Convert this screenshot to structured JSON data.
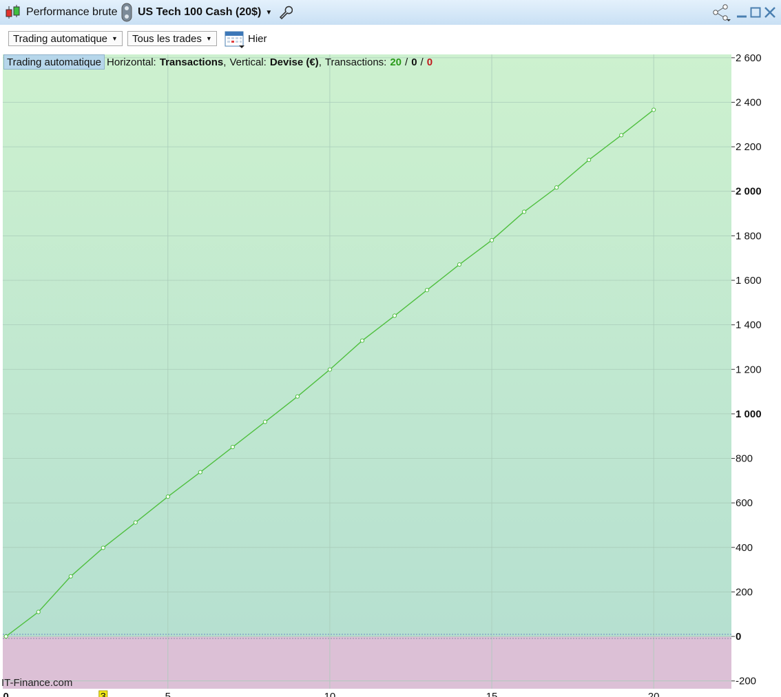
{
  "window": {
    "tab_title": "Performance brute",
    "instrument": "US Tech 100 Cash (20$)"
  },
  "toolbar": {
    "mode_label": "Trading automatique",
    "filter_label": "Tous les trades",
    "date_label": "Hier"
  },
  "infobar": {
    "tag": "Trading automatique",
    "horizontal_label": "Horizontal:",
    "horizontal_value": "Transactions",
    "vertical_label": "Vertical:",
    "vertical_value": "Devise (€)",
    "transactions_label": "Transactions:",
    "transactions_win": "20",
    "transactions_neutral": "0",
    "transactions_loss": "0",
    "sep1": ",",
    "sep2": ",",
    "slash": "/"
  },
  "watermark": "IT-Finance.com",
  "colors": {
    "positive_zone": "#c8eecc",
    "negative_zone": "#dcc0d6",
    "line": "#4fbf3f",
    "win": "#2a9a1a",
    "loss": "#c0191d"
  },
  "chart_data": {
    "type": "line",
    "series": [
      {
        "x": [
          0,
          1,
          2,
          3,
          4,
          5,
          6,
          7,
          8,
          9,
          10,
          11,
          12,
          13,
          14,
          15,
          16,
          17,
          18,
          19,
          20
        ],
        "values": [
          0,
          110,
          270,
          398,
          512,
          628,
          738,
          851,
          964,
          1078,
          1199,
          1329,
          1441,
          1556,
          1671,
          1780,
          1908,
          2017,
          2141,
          2252,
          2366
        ]
      }
    ],
    "xlim": [
      -0.1,
      22.4
    ],
    "ylim": [
      -235,
      2615
    ],
    "yticks": [
      {
        "value": 2600,
        "label": "2 600",
        "bold": false
      },
      {
        "value": 2400,
        "label": "2 400",
        "bold": false
      },
      {
        "value": 2200,
        "label": "2 200",
        "bold": false
      },
      {
        "value": 2000,
        "label": "2 000",
        "bold": true
      },
      {
        "value": 1800,
        "label": "1 800",
        "bold": false
      },
      {
        "value": 1600,
        "label": "1 600",
        "bold": false
      },
      {
        "value": 1400,
        "label": "1 400",
        "bold": false
      },
      {
        "value": 1200,
        "label": "1 200",
        "bold": false
      },
      {
        "value": 1000,
        "label": "1 000",
        "bold": true
      },
      {
        "value": 800,
        "label": "800",
        "bold": false
      },
      {
        "value": 600,
        "label": "600",
        "bold": false
      },
      {
        "value": 400,
        "label": "400",
        "bold": false
      },
      {
        "value": 200,
        "label": "200",
        "bold": false
      },
      {
        "value": 0,
        "label": "0",
        "bold": true
      },
      {
        "value": -200,
        "label": "-200",
        "bold": false
      }
    ],
    "xticks": [
      {
        "value": 0,
        "label": "0"
      },
      {
        "value": 3,
        "label": "3"
      },
      {
        "value": 5,
        "label": "5"
      },
      {
        "value": 10,
        "label": "10"
      },
      {
        "value": 15,
        "label": "15"
      },
      {
        "value": 20,
        "label": "20"
      }
    ],
    "grid": true
  }
}
